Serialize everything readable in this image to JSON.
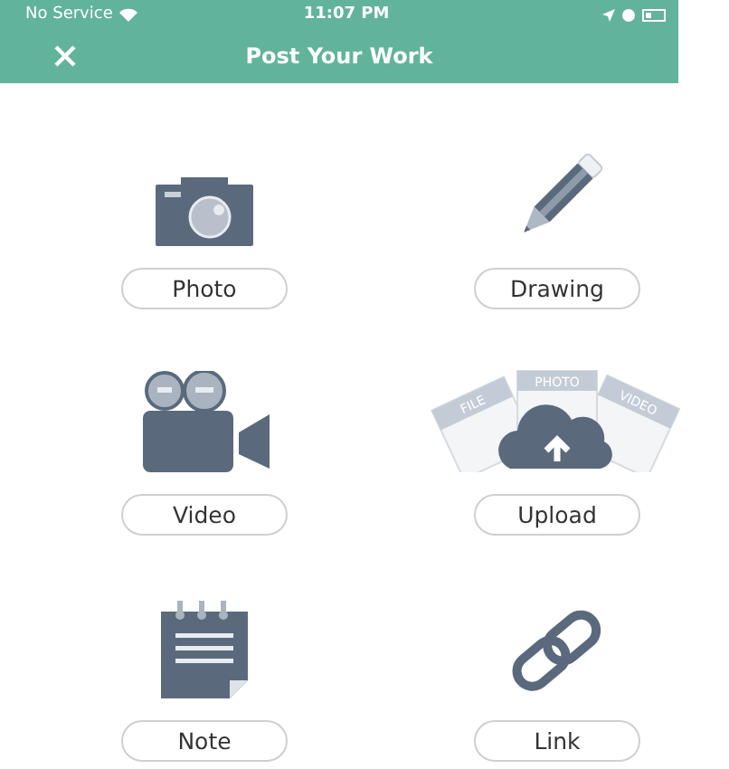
{
  "status_bar": {
    "carrier": "No Service",
    "time": "11:07 PM"
  },
  "nav_bar": {
    "title": "Post Your Work"
  },
  "options": [
    {
      "kind": "photo",
      "label": "Photo"
    },
    {
      "kind": "drawing",
      "label": "Drawing"
    },
    {
      "kind": "video",
      "label": "Video"
    },
    {
      "kind": "upload",
      "label": "Upload",
      "tags": [
        "FILE",
        "PHOTO",
        "VIDEO"
      ]
    },
    {
      "kind": "note",
      "label": "Note"
    },
    {
      "kind": "link",
      "label": "Link"
    }
  ]
}
